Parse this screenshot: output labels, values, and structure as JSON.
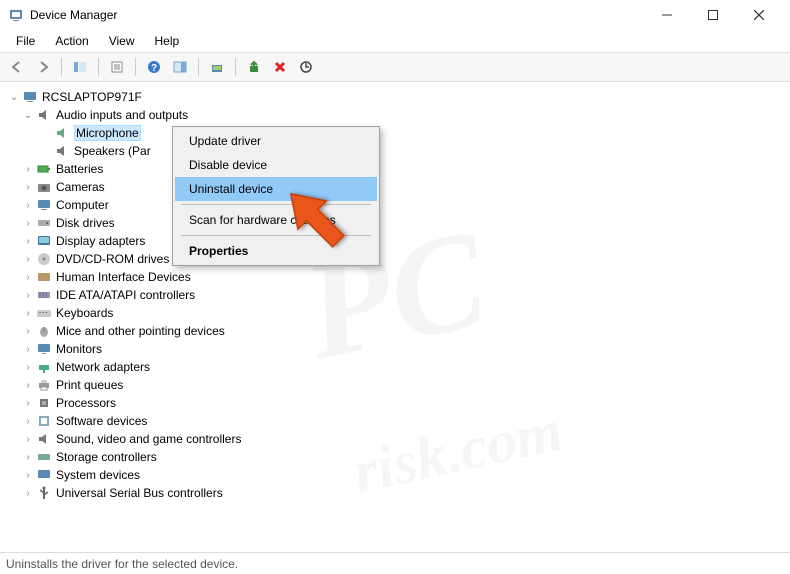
{
  "window": {
    "title": "Device Manager"
  },
  "menubar": {
    "file": "File",
    "action": "Action",
    "view": "View",
    "help": "Help"
  },
  "tree": {
    "root": "RCSLAPTOP971F",
    "audio": "Audio inputs and outputs",
    "microphone": "Microphone",
    "speakers": "Speakers (Par",
    "batteries": "Batteries",
    "cameras": "Cameras",
    "computer": "Computer",
    "disk_drives": "Disk drives",
    "display_adapters": "Display adapters",
    "dvd": "DVD/CD-ROM drives",
    "hid": "Human Interface Devices",
    "ide": "IDE ATA/ATAPI controllers",
    "keyboards": "Keyboards",
    "mice": "Mice and other pointing devices",
    "monitors": "Monitors",
    "network": "Network adapters",
    "print_queues": "Print queues",
    "processors": "Processors",
    "software_devices": "Software devices",
    "sound": "Sound, video and game controllers",
    "storage": "Storage controllers",
    "system_devices": "System devices",
    "usb": "Universal Serial Bus controllers"
  },
  "context_menu": {
    "update_driver": "Update driver",
    "disable_device": "Disable device",
    "uninstall_device": "Uninstall device",
    "scan": "Scan for hardware changes",
    "properties": "Properties"
  },
  "statusbar": {
    "text": "Uninstalls the driver for the selected device."
  },
  "watermark": {
    "main": "PC",
    "sub": "risk.com"
  }
}
